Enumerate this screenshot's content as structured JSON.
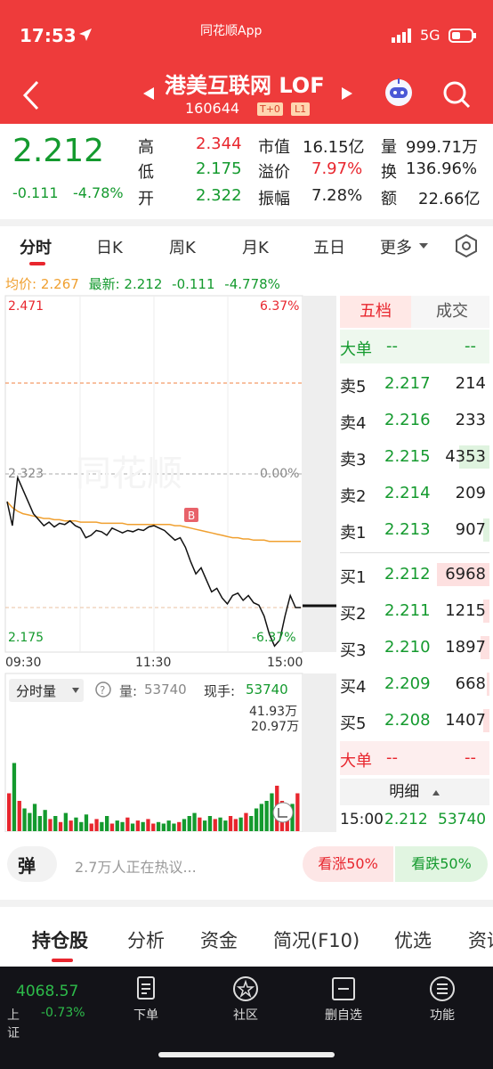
{
  "status_bar": {
    "time": "17:53",
    "app_name": "同花顺App",
    "network": "5G"
  },
  "header": {
    "title": "港美互联网 LOF",
    "code": "160644",
    "badge1": "T+0",
    "badge2": "L1"
  },
  "quote": {
    "price": "2.212",
    "change": "-0.111",
    "change_pct": "-4.78%",
    "fields": [
      {
        "label": "高",
        "value": "2.344"
      },
      {
        "label": "低",
        "value": "2.175"
      },
      {
        "label": "开",
        "value": "2.322"
      },
      {
        "label": "市值",
        "value": "16.15亿"
      },
      {
        "label": "溢价",
        "value": "7.97%"
      },
      {
        "label": "振幅",
        "value": "7.28%"
      },
      {
        "label": "量",
        "value": "999.71万"
      },
      {
        "label": "换",
        "value": "136.96%"
      },
      {
        "label": "额",
        "value": "22.66亿"
      }
    ]
  },
  "tabs": [
    "分时",
    "日K",
    "周K",
    "月K",
    "五日",
    "更多"
  ],
  "chart_info": {
    "avg_label": "均价:",
    "avg_value": "2.267",
    "latest_label": "最新:",
    "latest_value": "2.212",
    "latest_change": "-0.111",
    "latest_pct": "-4.778%"
  },
  "chart_data": {
    "type": "line",
    "y_max_label": "2.471",
    "y_max_pct": "6.37%",
    "y_mid_label": "2.323",
    "y_mid_pct": "0.00%",
    "y_min_label": "2.175",
    "y_min_pct": "-6.37%",
    "x_labels": [
      "09:30",
      "11:30",
      "15:00"
    ],
    "ylim": [
      2.175,
      2.471
    ],
    "price": [
      2.3,
      2.28,
      2.32,
      2.31,
      2.3,
      2.29,
      2.285,
      2.28,
      2.283,
      2.279,
      2.282,
      2.281,
      2.284,
      2.28,
      2.278,
      2.27,
      2.272,
      2.276,
      2.275,
      2.272,
      2.278,
      2.276,
      2.274,
      2.276,
      2.275,
      2.277,
      2.276,
      2.279,
      2.28,
      2.278,
      2.276,
      2.272,
      2.268,
      2.27,
      2.262,
      2.25,
      2.24,
      2.245,
      2.235,
      2.225,
      2.228,
      2.22,
      2.215,
      2.222,
      2.224,
      2.218,
      2.222,
      2.216,
      2.214,
      2.205,
      2.19,
      2.18,
      2.185,
      2.205,
      2.222,
      2.212,
      2.212
    ],
    "avg": [
      2.3,
      2.295,
      2.292,
      2.29,
      2.289,
      2.288,
      2.287,
      2.286,
      2.286,
      2.285,
      2.285,
      2.284,
      2.284,
      2.284,
      2.283,
      2.283,
      2.283,
      2.283,
      2.282,
      2.282,
      2.282,
      2.282,
      2.282,
      2.281,
      2.281,
      2.281,
      2.281,
      2.281,
      2.281,
      2.281,
      2.281,
      2.281,
      2.28,
      2.28,
      2.279,
      2.278,
      2.277,
      2.276,
      2.275,
      2.274,
      2.273,
      2.272,
      2.271,
      2.27,
      2.27,
      2.269,
      2.269,
      2.268,
      2.268,
      2.268,
      2.267,
      2.267,
      2.267,
      2.267,
      2.267,
      2.267,
      2.267
    ],
    "volume_label": "分时量",
    "volume_value_label": "量:",
    "volume_value": "53740",
    "hand_label": "现手:",
    "hand_value": "53740",
    "vol_max_label": "41.93万",
    "vol_mid_label": "20.97万",
    "volumes": [
      0.25,
      0.45,
      0.2,
      0.15,
      0.12,
      0.18,
      0.1,
      0.14,
      0.08,
      0.1,
      0.06,
      0.12,
      0.07,
      0.09,
      0.06,
      0.11,
      0.05,
      0.08,
      0.06,
      0.1,
      0.05,
      0.07,
      0.06,
      0.09,
      0.05,
      0.07,
      0.06,
      0.08,
      0.05,
      0.06,
      0.05,
      0.07,
      0.05,
      0.06,
      0.08,
      0.1,
      0.12,
      0.09,
      0.07,
      0.1,
      0.08,
      0.09,
      0.07,
      0.1,
      0.08,
      0.09,
      0.12,
      0.1,
      0.15,
      0.18,
      0.2,
      0.25,
      0.3,
      0.2,
      0.15,
      0.18,
      0.25
    ],
    "watermark": "同花顺"
  },
  "orderbook": {
    "tab_active": "五档",
    "tab_inactive": "成交",
    "big_label": "大单",
    "big_dash1": "--",
    "big_dash2": "--",
    "asks": [
      {
        "label": "卖5",
        "price": "2.217",
        "vol": "214",
        "bar": 0.0
      },
      {
        "label": "卖4",
        "price": "2.216",
        "vol": "233",
        "bar": 0.0
      },
      {
        "label": "卖3",
        "price": "2.215",
        "vol": "4353",
        "bar": 0.2
      },
      {
        "label": "卖2",
        "price": "2.214",
        "vol": "209",
        "bar": 0.0
      },
      {
        "label": "卖1",
        "price": "2.213",
        "vol": "907",
        "bar": 0.04
      }
    ],
    "bids": [
      {
        "label": "买1",
        "price": "2.212",
        "vol": "6968",
        "bar": 0.35
      },
      {
        "label": "买2",
        "price": "2.211",
        "vol": "1215",
        "bar": 0.04
      },
      {
        "label": "买3",
        "price": "2.210",
        "vol": "1897",
        "bar": 0.06
      },
      {
        "label": "买4",
        "price": "2.209",
        "vol": "668",
        "bar": 0.02
      },
      {
        "label": "买5",
        "price": "2.208",
        "vol": "1407",
        "bar": 0.04
      }
    ],
    "big2_label": "大单",
    "big2_dash1": "--",
    "big2_dash2": "--",
    "detail_label": "明细",
    "detail_time": "15:00",
    "detail_price": "2.212",
    "detail_vol": "53740"
  },
  "comment_bar": {
    "bubble": "弹",
    "text": "2.7万人正在热议...",
    "bull": "看涨50%",
    "bear": "看跌50%"
  },
  "section_tabs": [
    "持仓股",
    "分析",
    "资金",
    "简况(F10)",
    "优选",
    "资讯"
  ],
  "bottom_nav": {
    "index_value": "4068.57",
    "index_name": "上证",
    "index_pct": "-0.73%",
    "items": [
      "下单",
      "社区",
      "删自选",
      "功能"
    ]
  },
  "colors": {
    "red": "#e8262e",
    "green": "#149a2e",
    "header": "#ee3b3b",
    "avg_line": "#f0a030"
  }
}
